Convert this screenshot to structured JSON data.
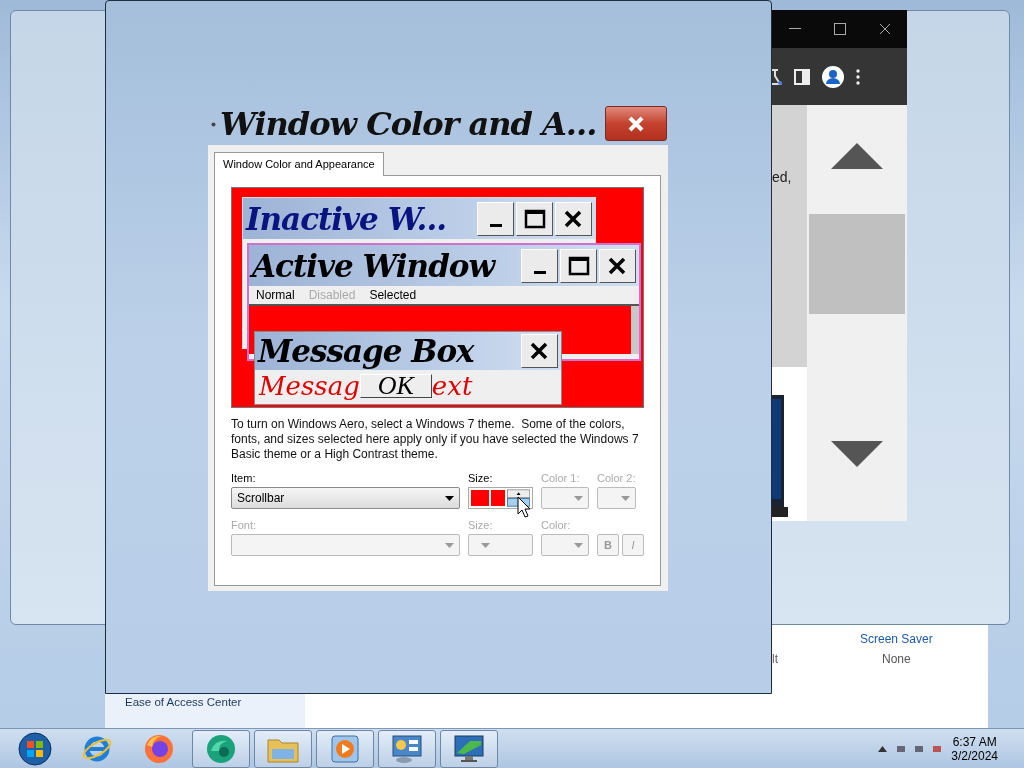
{
  "control_panel": {
    "sidebar_links": [
      "Ease of Access Center"
    ],
    "fragment": "lt",
    "screen_saver": {
      "label": "Screen Saver",
      "value": "None"
    }
  },
  "browser": {
    "text_fragment": "ed,"
  },
  "dialog": {
    "title": "Window Color and A...",
    "tabs": [
      {
        "label": "Window Color and Appearance",
        "selected": true
      }
    ],
    "preview": {
      "inactive_title": "Inactive W...",
      "active_title": "Active Window",
      "menu": [
        {
          "label": "Normal",
          "kind": "normal"
        },
        {
          "label": "Disabled",
          "kind": "disabled"
        },
        {
          "label": "Selected",
          "kind": "selected"
        }
      ],
      "message_title": "Message Box",
      "message_text_start": "Messag",
      "ok_button": "OK",
      "message_text_end": "ext"
    },
    "description": "To turn on Windows Aero, select a Windows 7 theme.  Some of the colors, fonts, and sizes selected here apply only if you have selected the Windows 7 Basic theme or a High Contrast theme.",
    "fields": [
      {
        "label": "Item:",
        "value": "Scrollbar",
        "kind": "combo",
        "disabled": false
      },
      {
        "label": "Size:",
        "kind": "spinner",
        "disabled": false
      },
      {
        "label": "Color 1:",
        "kind": "color",
        "disabled": true
      },
      {
        "label": "Color 2:",
        "kind": "color",
        "disabled": true
      },
      {
        "label": "Font:",
        "kind": "combo",
        "disabled": true
      },
      {
        "label": "Size:",
        "kind": "small-combo",
        "disabled": true
      },
      {
        "label": "Color:",
        "kind": "color",
        "disabled": true
      },
      {
        "text": "B",
        "kind": "toggle",
        "disabled": true
      },
      {
        "text": "I",
        "kind": "toggle",
        "disabled": true
      }
    ]
  },
  "taskbar": {
    "items": [
      {
        "kind": "start",
        "running": false
      },
      {
        "kind": "ring",
        "running": false
      },
      {
        "kind": "globe",
        "running": false
      },
      {
        "kind": "swirl",
        "running": true
      },
      {
        "kind": "folder",
        "running": true
      },
      {
        "kind": "media",
        "running": true
      },
      {
        "kind": "panel",
        "running": true
      },
      {
        "kind": "monitor",
        "running": true
      }
    ],
    "clock": {
      "time": "6:37 AM",
      "date": "3/2/2024"
    }
  }
}
